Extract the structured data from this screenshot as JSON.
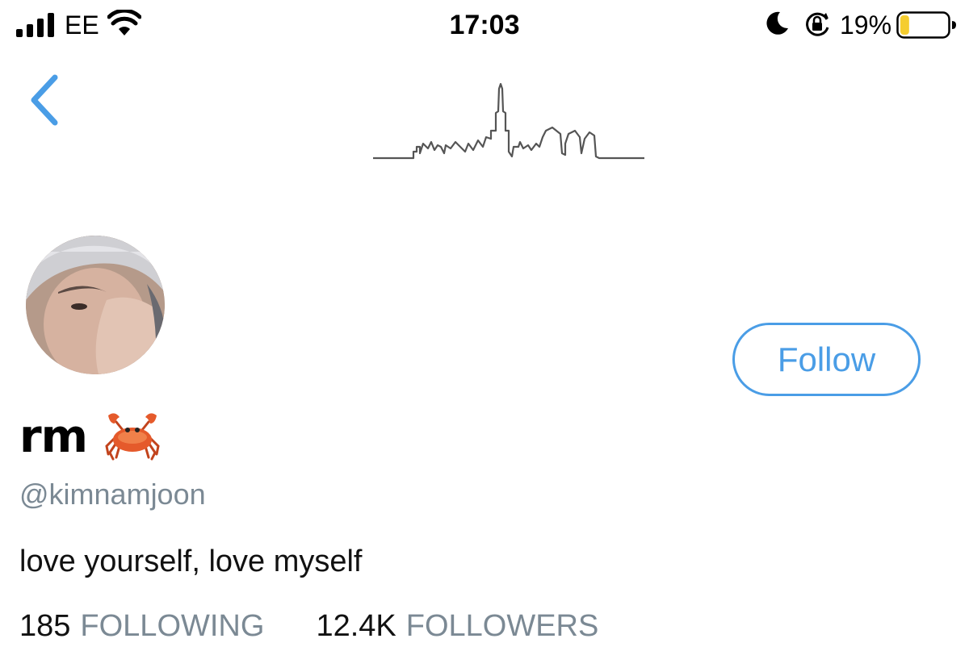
{
  "status_bar": {
    "carrier": "EE",
    "time": "17:03",
    "battery_percent": "19%",
    "battery_level": 0.19,
    "icons": [
      "signal-icon",
      "wifi-icon",
      "moon-icon",
      "rotation-lock-icon",
      "battery-icon"
    ]
  },
  "nav": {
    "back_icon": "chevron-left-icon",
    "logo_icon": "city-skyline-icon"
  },
  "profile": {
    "display_name": "rm",
    "emoji": "crab-icon",
    "handle": "@kimnamjoon",
    "bio": "love yourself, love myself",
    "follow_label": "Follow",
    "stats": [
      {
        "count": "185",
        "label": "FOLLOWING"
      },
      {
        "count": "12.4K",
        "label": "FOLLOWERS"
      }
    ]
  },
  "colors": {
    "accent": "#4a9de6",
    "muted_text": "#7b8994",
    "battery_fill": "#f5cd2f"
  }
}
